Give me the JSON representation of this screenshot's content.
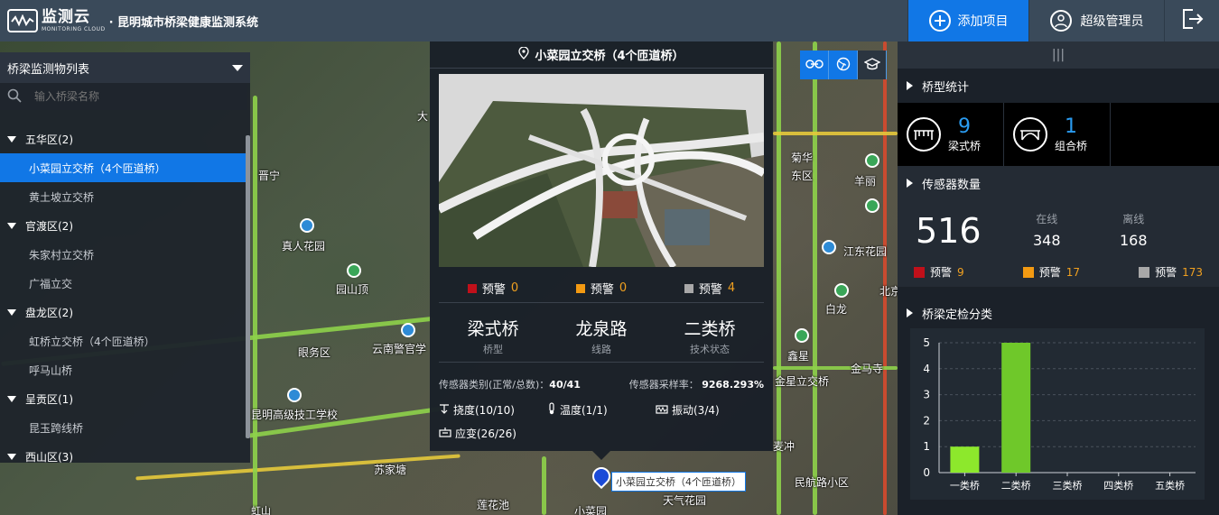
{
  "header": {
    "brand_name": "监测云",
    "brand_sub": "MONITORING CLOUD",
    "system_title": "· 昆明城市桥梁健康监测系统",
    "add_project": "添加项目",
    "admin": "超级管理员"
  },
  "left_panel": {
    "title": "桥梁监测物列表",
    "search_placeholder": "输入桥梁名称",
    "groups": [
      {
        "label": "五华区(2)",
        "items": [
          "小菜园立交桥（4个匝道桥）",
          "黄土坡立交桥"
        ]
      },
      {
        "label": "官渡区(2)",
        "items": [
          "朱家村立交桥",
          "广福立交"
        ]
      },
      {
        "label": "盘龙区(2)",
        "items": [
          "虹桥立交桥（4个匝道桥）",
          "呼马山桥"
        ]
      },
      {
        "label": "呈贡区(1)",
        "items": [
          "昆玉跨线桥"
        ]
      },
      {
        "label": "西山区(3)",
        "items": []
      }
    ]
  },
  "map_labels": [
    "晋宁",
    "真人花园",
    "园山顶",
    "云南警官学",
    "眼务区",
    "昆明高级技工学校",
    "苏家塘",
    "小菜园",
    "天气花园",
    "莲花池",
    "羊丽",
    "菊华",
    "东区",
    "江东花园",
    "鑫星",
    "金星立交桥",
    "金马寺",
    "白龙",
    "民航路小区",
    "北京",
    "大",
    "麦冲",
    "虹山"
  ],
  "card": {
    "title": "小菜园立交桥（4个匝道桥）",
    "alerts": [
      {
        "label": "预警",
        "value": "0",
        "color": "#c0101a"
      },
      {
        "label": "预警",
        "value": "0",
        "color": "#f39a12"
      },
      {
        "label": "预警",
        "value": "4",
        "color": "#a8a8a8"
      }
    ],
    "info": [
      {
        "value": "梁式桥",
        "label": "桥型"
      },
      {
        "value": "龙泉路",
        "label": "线路"
      },
      {
        "value": "二类桥",
        "label": "技术状态"
      }
    ],
    "sensor_category_label": "传感器类别(正常/总数)：",
    "sensor_category_value": "40/41",
    "sensor_rate_label": "传感器采样率：",
    "sensor_rate_value": "9268.293%",
    "sensors": [
      "挠度(10/10)",
      "温度(1/1)",
      "振动(3/4)",
      "应变(26/26)"
    ]
  },
  "marker_label": "小菜园立交桥（4个匝道桥）",
  "right_panel": {
    "handle": "|||",
    "types_title": "桥型统计",
    "types": [
      {
        "count": "9",
        "label": "梁式桥"
      },
      {
        "count": "1",
        "label": "组合桥"
      }
    ],
    "sensor_title": "传感器数量",
    "sensor_total": "516",
    "online_label": "在线",
    "online_value": "348",
    "offline_label": "离线",
    "offline_value": "168",
    "sensor_alerts": [
      {
        "label": "预警",
        "value": "9",
        "color": "#c0101a"
      },
      {
        "label": "预警",
        "value": "17",
        "color": "#f39a12"
      },
      {
        "label": "预警",
        "value": "173",
        "color": "#a8a8a8"
      }
    ],
    "chart_title": "桥梁定检分类"
  },
  "chart_data": {
    "type": "bar",
    "categories": [
      "一类桥",
      "二类桥",
      "三类桥",
      "四类桥",
      "五类桥"
    ],
    "values": [
      1,
      5,
      0,
      0,
      0
    ],
    "ylim": [
      0,
      5
    ],
    "yticks": [
      0,
      1,
      2,
      3,
      4,
      5
    ],
    "colors": [
      "#8de82c",
      "#6fc82a",
      "#6fc82a",
      "#6fc82a",
      "#6fc82a"
    ],
    "grid": true
  }
}
